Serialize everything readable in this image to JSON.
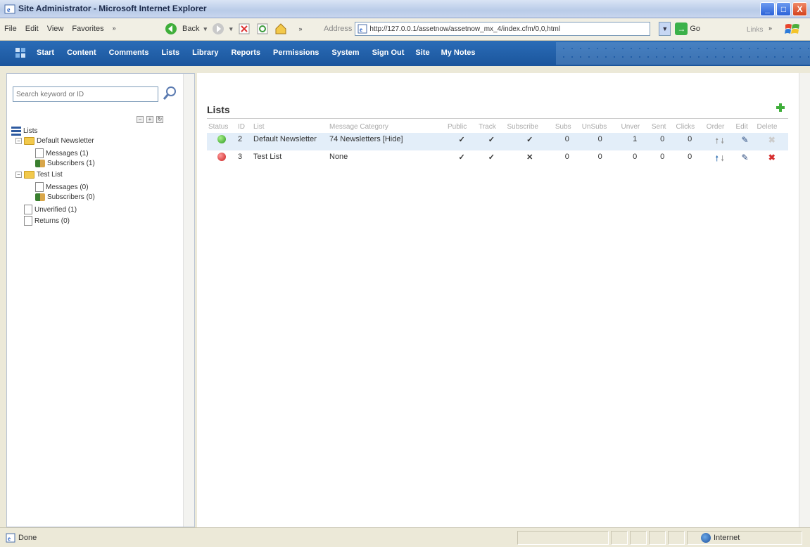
{
  "window": {
    "title": "Site Administrator - Microsoft Internet Explorer",
    "controls": [
      "_",
      "□",
      "X"
    ]
  },
  "menubar": {
    "menus": [
      "File",
      "Edit",
      "View",
      "Favorites"
    ],
    "back_label": "Back",
    "address_label": "Address",
    "url": "http://127.0.0.1/assetnow/assetnow_mx_4/index.cfm/0,0,html",
    "go_label": "Go",
    "links_label": "Links"
  },
  "appnav": {
    "items": [
      "Start",
      "Content",
      "Comments",
      "Lists",
      "Library",
      "Reports",
      "Permissions",
      "System",
      "Sign Out",
      "Site",
      "My Notes"
    ]
  },
  "sidebar": {
    "search_placeholder": "Search keyword or ID",
    "tree": {
      "root": "Lists",
      "lists": [
        {
          "label": "Default Newsletter",
          "children": [
            "Messages (1)",
            "Subscribers (1)"
          ]
        },
        {
          "label": "Test List",
          "children": [
            "Messages (0)",
            "Subscribers (0)"
          ]
        }
      ],
      "extras": [
        "Unverified (1)",
        "Returns (0)"
      ]
    }
  },
  "main": {
    "title": "Lists",
    "columns": [
      "Status",
      "ID",
      "List",
      "Message Category",
      "Public",
      "Track",
      "Subscribe",
      "Subs",
      "UnSubs",
      "Unver",
      "Sent",
      "Clicks",
      "Order",
      "Edit",
      "Delete"
    ],
    "rows": [
      {
        "status": "active",
        "id": "2",
        "list": "Default Newsletter",
        "category": "74 Newsletters [Hide]",
        "public": "✓",
        "track": "✓",
        "subscribe": "✓",
        "subs": "0",
        "unsubs": "0",
        "unver": "1",
        "sent": "0",
        "clicks": "0"
      },
      {
        "status": "inactive",
        "id": "3",
        "list": "Test List",
        "category": "None",
        "public": "✓",
        "track": "✓",
        "subscribe": "✕",
        "subs": "0",
        "unsubs": "0",
        "unver": "0",
        "sent": "0",
        "clicks": "0"
      }
    ]
  },
  "statusbar": {
    "status": "Done",
    "zone": "Internet"
  },
  "colors": {
    "nav_bg": "#1f5fa8",
    "active": "#2d9a1f",
    "inactive": "#c81e1e",
    "check": "#4a9a3a",
    "cross": "#d62e2e"
  }
}
